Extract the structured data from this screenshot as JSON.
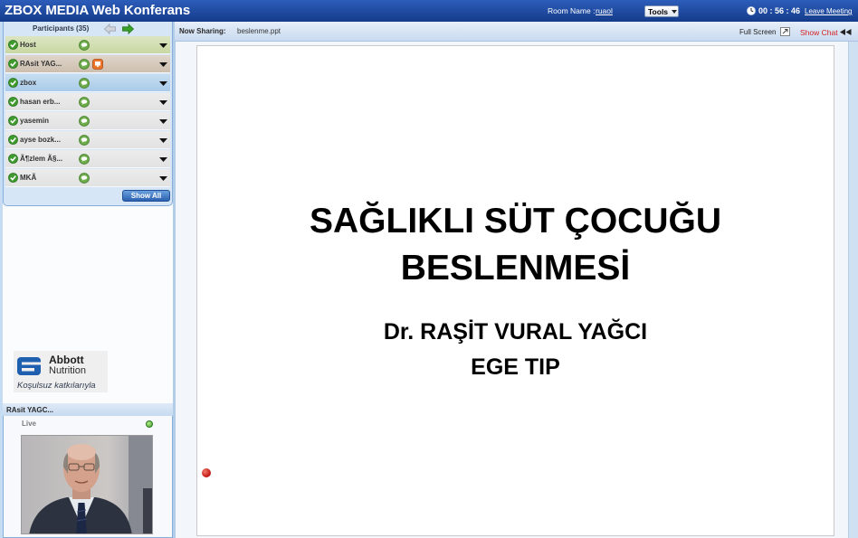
{
  "app": {
    "title": "ZBOX MEDIA Web Konferans"
  },
  "topbar": {
    "room_label": "Room Name :",
    "room_value": "ruaol",
    "tools_label": "Tools",
    "timer": "00 : 56 : 46",
    "leave_label": "Leave Meeting"
  },
  "participants": {
    "header": "Participants (35)",
    "show_all_label": "Show All",
    "items": [
      {
        "name": "Host",
        "color": "#c9d8a2"
      },
      {
        "name": "RAsit YAG...",
        "color": "#cdbfae"
      },
      {
        "name": "zbox",
        "color": "#a9cbe9"
      },
      {
        "name": "hasan erb...",
        "color": "#e2e2e2"
      },
      {
        "name": "yasemin",
        "color": "#e2e2e2"
      },
      {
        "name": "ayse bozk...",
        "color": "#e2e2e2"
      },
      {
        "name": "Ã¶zlem Ã§...",
        "color": "#e2e2e2"
      },
      {
        "name": "MKÃ",
        "color": "#e2e2e2"
      }
    ]
  },
  "sharing": {
    "label": "Now Sharing:",
    "file": "beslenme.ppt",
    "fullscreen_label": "Full Screen",
    "show_chat_label": "Show Chat"
  },
  "sponsor": {
    "brand": "Abbott",
    "division": "Nutrition",
    "caption": "Koşulsuz katkılarıyla"
  },
  "video": {
    "name": "RAsit YAGC...",
    "status": "Live"
  },
  "slide": {
    "title_line1": "SAĞLIKLI SÜT ÇOCUĞU",
    "title_line2": "BESLENMESİ",
    "author": "Dr. RAŞİT VURAL YAĞCI",
    "institution": "EGE TIP"
  },
  "icons": [
    "online-check-icon",
    "chat-bubble-icon",
    "presenter-icon",
    "chevron-down-icon",
    "arrow-left-icon",
    "arrow-right-icon",
    "clock-icon",
    "fullscreen-icon",
    "collapse-chat-icon",
    "abbott-logo-icon",
    "laser-pointer-icon"
  ],
  "colors": {
    "topbar": "#1d4596",
    "show_chat": "#d42020",
    "online": "#3f9b2e",
    "pointer": "#c8201a",
    "button": "#2b61b0"
  }
}
